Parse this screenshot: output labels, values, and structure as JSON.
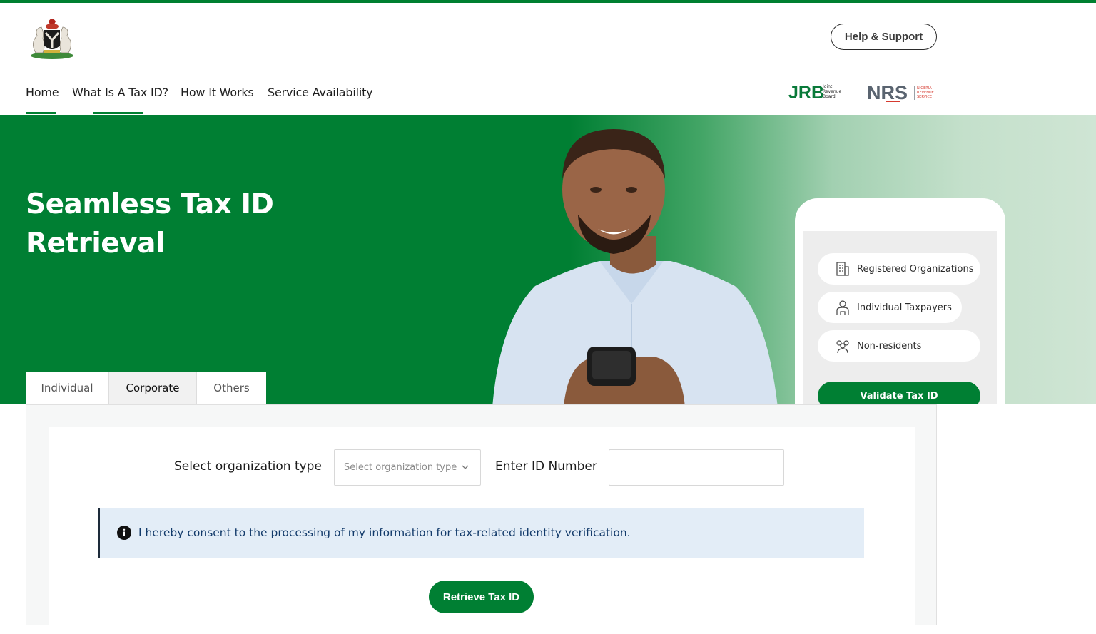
{
  "header": {
    "help_label": "Help & Support",
    "crest_icon": "nigeria-coat-of-arms-icon"
  },
  "nav": {
    "items": [
      "Home",
      "What Is A Tax ID?",
      "How It Works",
      "Service Availability"
    ],
    "active_index": 0
  },
  "partners": {
    "jrb_mark": "JRB",
    "jrb_text": [
      "Joint",
      "Revenue",
      "Board"
    ],
    "nrs_mark": "NRS",
    "nrs_text": [
      "NIGERIA",
      "REVENUE",
      "SERVICE"
    ]
  },
  "hero": {
    "title": "Seamless Tax ID Retrieval",
    "phone": {
      "options": [
        "Registered Organizations",
        "Individual Taxpayers",
        "Non-residents"
      ],
      "validate_label": "Validate Tax ID"
    }
  },
  "tabs": [
    "Individual",
    "Corporate",
    "Others"
  ],
  "active_tab": "Corporate",
  "form": {
    "org_type_label": "Select organization type",
    "org_type_placeholder": "Select organization type",
    "id_label": "Enter ID Number",
    "id_value": "",
    "consent_text": "I hereby consent to the processing of my information for tax-related identity verification.",
    "submit_label": "Retrieve Tax ID"
  },
  "colors": {
    "brand_green": "#007f33",
    "info_bg": "#e3edf7",
    "info_text": "#123a6a"
  }
}
